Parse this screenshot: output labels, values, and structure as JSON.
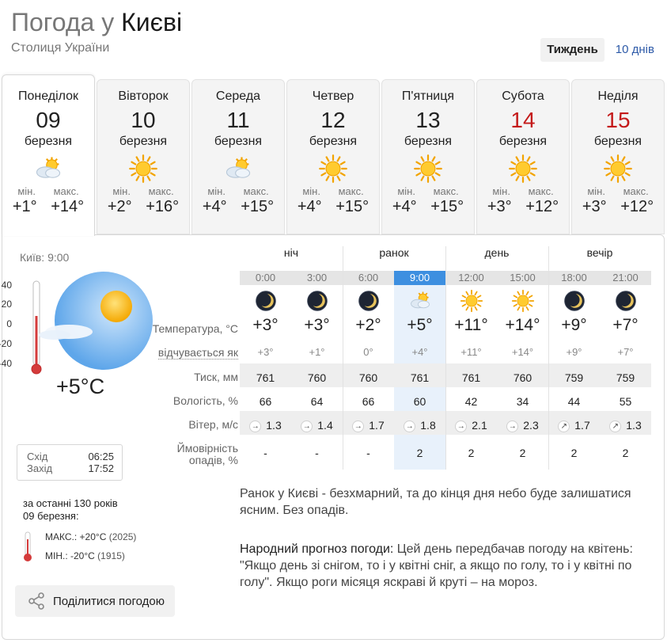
{
  "header": {
    "title_prefix": "Погода",
    "title_prep": "у",
    "title_city": "Києві",
    "subtitle": "Столиця України",
    "range_week": "Тиждень",
    "range_10days": "10 днів"
  },
  "days": [
    {
      "name": "Понеділок",
      "num": "09",
      "month": "березня",
      "icon": "sun-cloud-icon",
      "min_label": "мін.",
      "max_label": "макс.",
      "min": "+1°",
      "max": "+14°",
      "weekend": false,
      "active": true
    },
    {
      "name": "Вівторок",
      "num": "10",
      "month": "березня",
      "icon": "sun-icon",
      "min_label": "мін.",
      "max_label": "макс.",
      "min": "+2°",
      "max": "+16°",
      "weekend": false,
      "active": false
    },
    {
      "name": "Середа",
      "num": "11",
      "month": "березня",
      "icon": "sun-cloud-icon",
      "min_label": "мін.",
      "max_label": "макс.",
      "min": "+4°",
      "max": "+15°",
      "weekend": false,
      "active": false
    },
    {
      "name": "Четвер",
      "num": "12",
      "month": "березня",
      "icon": "sun-icon",
      "min_label": "мін.",
      "max_label": "макс.",
      "min": "+4°",
      "max": "+15°",
      "weekend": false,
      "active": false
    },
    {
      "name": "П'ятниця",
      "num": "13",
      "month": "березня",
      "icon": "sun-icon",
      "min_label": "мін.",
      "max_label": "макс.",
      "min": "+4°",
      "max": "+15°",
      "weekend": false,
      "active": false
    },
    {
      "name": "Субота",
      "num": "14",
      "month": "березня",
      "icon": "sun-icon",
      "min_label": "мін.",
      "max_label": "макс.",
      "min": "+3°",
      "max": "+12°",
      "weekend": true,
      "active": false
    },
    {
      "name": "Неділя",
      "num": "15",
      "month": "березня",
      "icon": "sun-icon",
      "min_label": "мін.",
      "max_label": "макс.",
      "min": "+3°",
      "max": "+12°",
      "weekend": true,
      "active": false
    }
  ],
  "current": {
    "label": "Київ: 9:00",
    "temp": "+5°C",
    "scale": [
      "40",
      "20",
      "0",
      "-20",
      "-40"
    ],
    "sunrise_label": "Схід",
    "sunrise": "06:25",
    "sunset_label": "Захід",
    "sunset": "17:52"
  },
  "history": {
    "line1": "за останні 130 років",
    "line2": "09 березня:",
    "max_label": "МАКС.:",
    "max_value": "+20°C",
    "max_year": "(2025)",
    "min_label": "МІН.:",
    "min_value": "-20°C",
    "min_year": "(1915)"
  },
  "share_label": "Поділитися погодою",
  "row_labels": {
    "temp": "Температура, °C",
    "feels": "відчувається як",
    "pressure": "Тиск, мм",
    "humidity": "Вологість, %",
    "wind": "Вітер, м/с",
    "precip_1": "Ймовірність",
    "precip_2": "опадів, %"
  },
  "periods": [
    "ніч",
    "ранок",
    "день",
    "вечір"
  ],
  "hours": [
    {
      "time": "0:00",
      "icon": "moon-icon",
      "temp": "+3°",
      "feels": "+3°",
      "pressure": "761",
      "humidity": "66",
      "wind_dir": "→",
      "wind": "1.3",
      "precip": "-"
    },
    {
      "time": "3:00",
      "icon": "moon-icon",
      "temp": "+3°",
      "feels": "+1°",
      "pressure": "760",
      "humidity": "64",
      "wind_dir": "→",
      "wind": "1.4",
      "precip": "-"
    },
    {
      "time": "6:00",
      "icon": "moon-icon",
      "temp": "+2°",
      "feels": "0°",
      "pressure": "760",
      "humidity": "66",
      "wind_dir": "→",
      "wind": "1.7",
      "precip": "-"
    },
    {
      "time": "9:00",
      "icon": "sun-cloud-icon",
      "temp": "+5°",
      "feels": "+4°",
      "pressure": "761",
      "humidity": "60",
      "wind_dir": "→",
      "wind": "1.8",
      "precip": "2"
    },
    {
      "time": "12:00",
      "icon": "sun-icon",
      "temp": "+11°",
      "feels": "+11°",
      "pressure": "761",
      "humidity": "42",
      "wind_dir": "→",
      "wind": "2.1",
      "precip": "2"
    },
    {
      "time": "15:00",
      "icon": "sun-icon",
      "temp": "+14°",
      "feels": "+14°",
      "pressure": "760",
      "humidity": "34",
      "wind_dir": "→",
      "wind": "2.3",
      "precip": "2"
    },
    {
      "time": "18:00",
      "icon": "moon-icon",
      "temp": "+9°",
      "feels": "+9°",
      "pressure": "759",
      "humidity": "44",
      "wind_dir": "↗",
      "wind": "1.7",
      "precip": "2"
    },
    {
      "time": "21:00",
      "icon": "moon-icon",
      "temp": "+7°",
      "feels": "+7°",
      "pressure": "759",
      "humidity": "55",
      "wind_dir": "↗",
      "wind": "1.3",
      "precip": "2"
    }
  ],
  "summary": "Ранок у Києві - безхмарний, та до кінця дня небо буде залишатися ясним. Без опадів.",
  "folk": {
    "label": "Народний прогноз погоди:",
    "text": "Цей день передбачав погоду на квітень: \"Якщо день зі снігом, то і у квітні сніг, а якщо по голу, то і у квітні по голу\". Якщо роги місяця яскраві й круті – на мороз."
  },
  "colors": {
    "accent": "#3d8fe0",
    "weekend": "#c41a1a",
    "link": "#2d5aa8"
  }
}
